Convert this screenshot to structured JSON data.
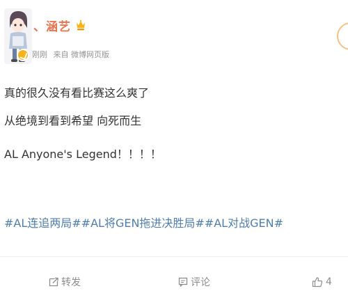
{
  "author": {
    "name": "、涵艺",
    "avatar_icon": "avatar-illustration-icon",
    "vip_icon": "crown-badge-icon",
    "verified_icon": "verified-badge-icon"
  },
  "meta": {
    "time": "刚刚",
    "source": "来自 微博网页版"
  },
  "post": {
    "lines": [
      "真的很久没有看比赛这么爽了",
      "从绝境到看到希望 向死而生",
      "AL Anyone's Legend！！！！"
    ],
    "hashtags": "#AL连追两局##AL将GEN拖进决胜局##AL对战GEN#"
  },
  "actions": {
    "repost_label": "转发",
    "comment_label": "评论",
    "like_count": "4"
  },
  "colors": {
    "username": "#eb7350",
    "hashtag": "#507daf",
    "meta": "#939393",
    "text": "#333333"
  }
}
